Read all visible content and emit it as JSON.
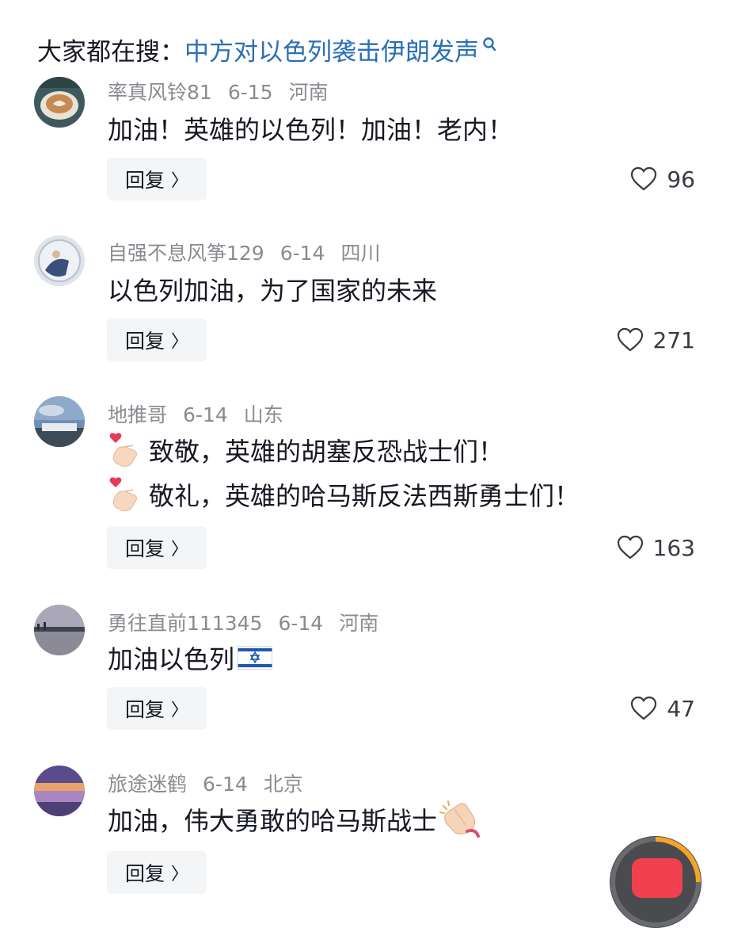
{
  "search": {
    "prefix": "大家都在搜：",
    "query": "中方对以色列袭击伊朗发声"
  },
  "comments": [
    {
      "username": "率真风铃81",
      "date": "6-15",
      "location": "河南",
      "lines": [
        "加油！英雄的以色列！加油！老内！"
      ],
      "reply_label": "回复",
      "likes": "96"
    },
    {
      "username": "自强不息风筝129",
      "date": "6-14",
      "location": "四川",
      "lines": [
        "以色列加油，为了国家的未来"
      ],
      "reply_label": "回复",
      "likes": "271"
    },
    {
      "username": "地推哥",
      "date": "6-14",
      "location": "山东",
      "lines": [
        "致敬，英雄的胡塞反恐战士们！",
        "敬礼，英雄的哈马斯反法西斯勇士们！"
      ],
      "reply_label": "回复",
      "likes": "163"
    },
    {
      "username": "勇往直前111345",
      "date": "6-14",
      "location": "河南",
      "lines": [
        "加油以色列"
      ],
      "reply_label": "回复",
      "likes": "47"
    },
    {
      "username": "旅途迷鹤",
      "date": "6-14",
      "location": "北京",
      "lines": [
        "加油，伟大勇敢的哈马斯战士"
      ],
      "reply_label": "回复",
      "likes": ""
    }
  ],
  "icons": {
    "search": "search-icon",
    "like": "heart-outline-icon",
    "reply_chevron": "chevron-right-icon",
    "heart_hand": "finger-heart-emoji",
    "flag": "israel-flag-emoji",
    "clap": "clapping-hands-emoji"
  },
  "colors": {
    "link": "#2b6fb6",
    "meta": "#8a8b91",
    "text": "#161823",
    "reply_bg": "#f4f5f6"
  }
}
